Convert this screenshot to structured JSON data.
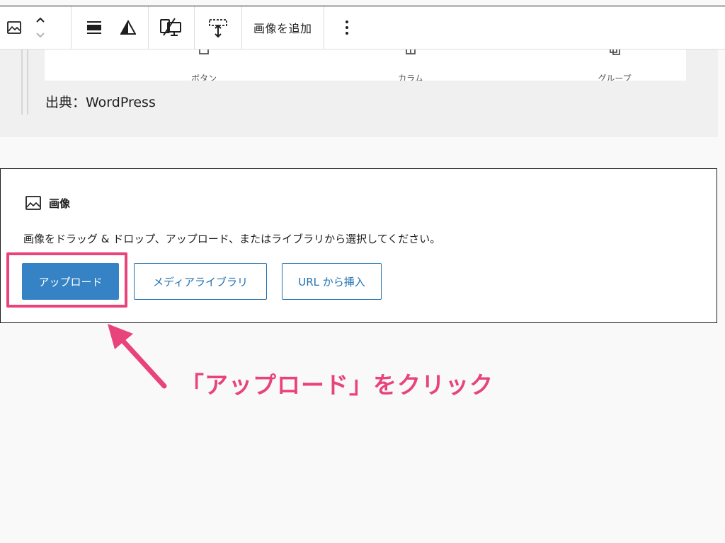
{
  "toolbar": {
    "add_image_label": "画像を追加",
    "icons": [
      "image-icon",
      "chevron-up-icon",
      "chevron-down-icon",
      "align-icon",
      "duotone-icon",
      "hide-on-mobile-icon",
      "resize-height-icon",
      "more-options-icon"
    ]
  },
  "quote": {
    "embed_items": [
      "ボタン",
      "カラム",
      "グループ"
    ],
    "caption": "出典：WordPress"
  },
  "image_block": {
    "title": "画像",
    "instructions": "画像をドラッグ & ドロップ、アップロード、またはライブラリから選択してください。",
    "upload_label": "アップロード",
    "media_library_label": "メディアライブラリ",
    "insert_url_label": "URL から挿入"
  },
  "annotation": {
    "text": "「アップロード」をクリック",
    "color": "#e8437a"
  },
  "colors": {
    "primary_button": "#3582c4",
    "link_blue": "#2271b1"
  }
}
